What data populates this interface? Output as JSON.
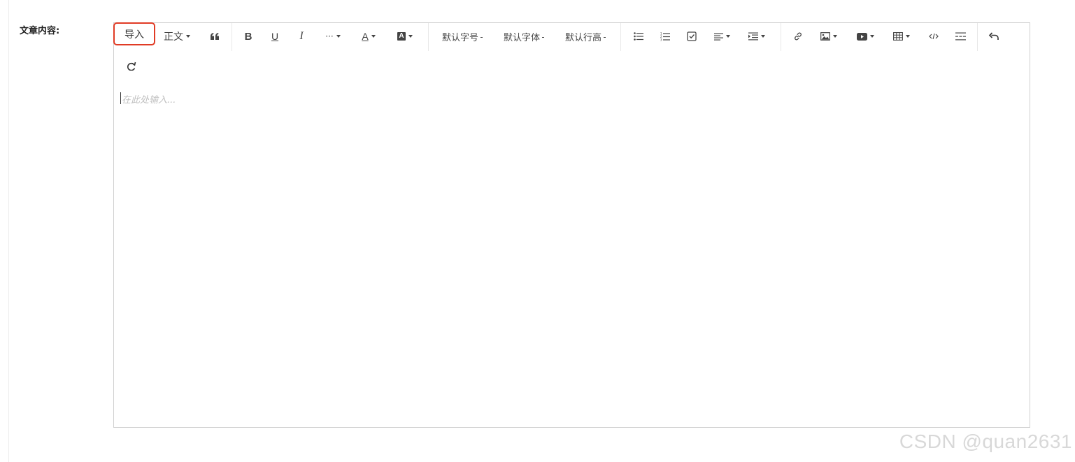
{
  "form": {
    "field_label": "文章内容:"
  },
  "toolbar": {
    "import_label": "导入",
    "heading_label": "正文",
    "font_size_label": "默认字号",
    "font_family_label": "默认字体",
    "line_height_label": "默认行高",
    "bold_label": "B",
    "underline_label": "U",
    "italic_label": "I",
    "more_label": "···",
    "font_color_label": "A",
    "bg_color_label": "A",
    "icons": {
      "quote": "quote-icon",
      "bullet_list": "bulleted-list-icon",
      "numbered_list": "numbered-list-icon",
      "todo": "checkbox-icon",
      "align": "align-left-icon",
      "indent": "indent-icon",
      "link": "link-icon",
      "image": "image-icon",
      "video": "video-icon",
      "table": "table-icon",
      "code": "code-icon",
      "divider": "divider-icon",
      "undo": "undo-icon",
      "redo": "redo-icon"
    }
  },
  "editor": {
    "placeholder": "在此处输入..."
  },
  "watermark": "CSDN @quan2631",
  "colors": {
    "highlight_border": "#e03b25",
    "editor_border": "#cfcfcf",
    "placeholder": "#c0c0c0"
  }
}
